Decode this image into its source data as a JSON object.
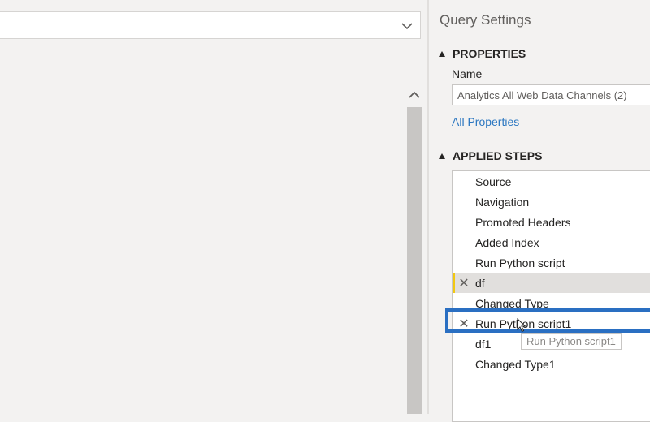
{
  "query_settings": {
    "title": "Query Settings",
    "properties": {
      "header": "PROPERTIES",
      "name_label": "Name",
      "name_value": "Analytics All Web Data Channels (2)",
      "all_properties_link": "All Properties"
    },
    "applied_steps": {
      "header": "APPLIED STEPS",
      "steps": [
        {
          "label": "Source"
        },
        {
          "label": "Navigation"
        },
        {
          "label": "Promoted Headers"
        },
        {
          "label": "Added Index"
        },
        {
          "label": "Run Python script"
        },
        {
          "label": "df"
        },
        {
          "label": "Changed Type"
        },
        {
          "label": "Run Python script1"
        },
        {
          "label": "df1"
        },
        {
          "label": "Changed Type1"
        }
      ],
      "tooltip": "Run Python script1"
    }
  },
  "colors": {
    "accent_highlight": "#2a6fc2",
    "link": "#2b77c1",
    "warning_bar": "#f2c811"
  },
  "icons": {
    "formula_expand": "chevron-down-icon",
    "scroll_up": "chevron-up-icon",
    "delete_step": "close-icon",
    "collapse_section": "triangle-down-icon",
    "cursor": "mouse-pointer-icon"
  }
}
